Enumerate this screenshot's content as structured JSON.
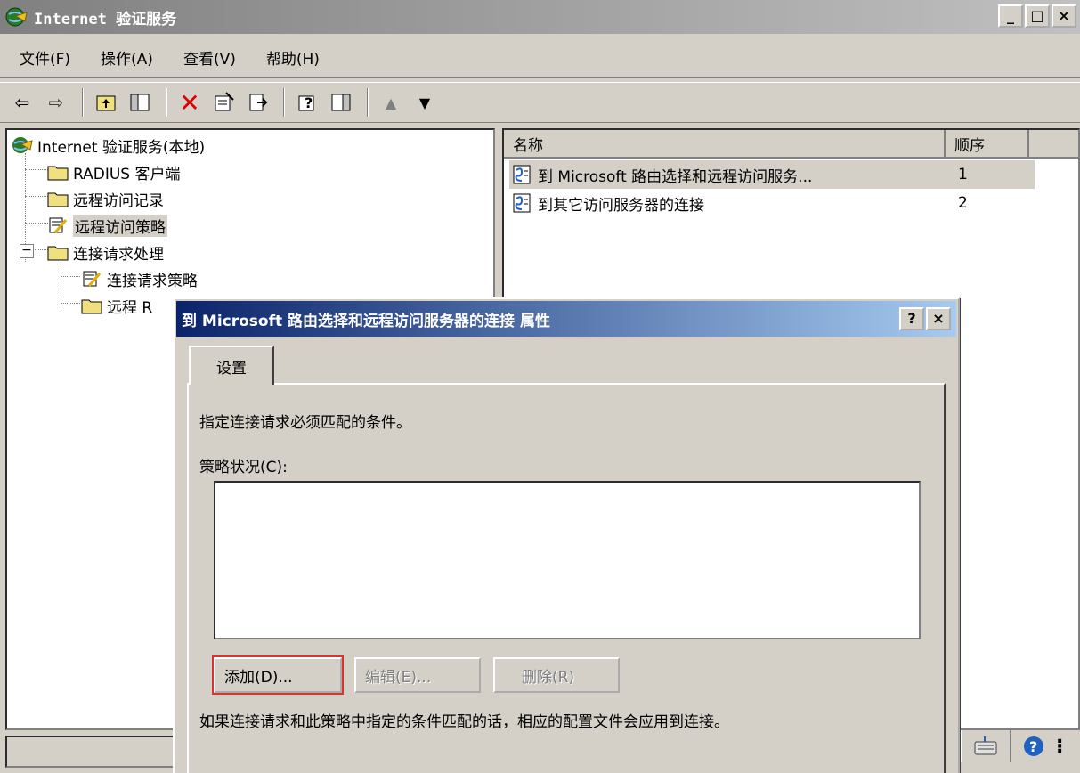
{
  "window": {
    "title": "Internet 验证服务",
    "minimize": "_",
    "maximize": "□",
    "close": "×"
  },
  "menu": [
    "文件(F)",
    "操作(A)",
    "查看(V)",
    "帮助(H)"
  ],
  "tree": {
    "root": "Internet 验证服务(本地)",
    "items": [
      {
        "label": "RADIUS 客户端"
      },
      {
        "label": "远程访问记录"
      },
      {
        "label": "远程访问策略"
      },
      {
        "label": "连接请求处理"
      },
      {
        "label": "连接请求策略"
      },
      {
        "label": "远程 R"
      }
    ],
    "collapse_symbol": "−"
  },
  "list": {
    "columns": [
      "名称",
      "顺序"
    ],
    "rows": [
      {
        "name": "到 Microsoft 路由选择和远程访问服务...",
        "order": "1"
      },
      {
        "name": "到其它访问服务器的连接",
        "order": "2"
      }
    ]
  },
  "dialog": {
    "title": "到 Microsoft 路由选择和远程访问服务器的连接 属性",
    "help": "?",
    "close": "×",
    "tab": "设置",
    "instruction": "指定连接请求必须匹配的条件。",
    "conditions_label": "策略状况(C):",
    "add_button": "添加(D)...",
    "edit_button": "编辑(E)...",
    "delete_button": "删除(R)",
    "footer": "如果连接请求和此策略中指定的条件匹配的话，相应的配置文件会应用到连接。"
  }
}
